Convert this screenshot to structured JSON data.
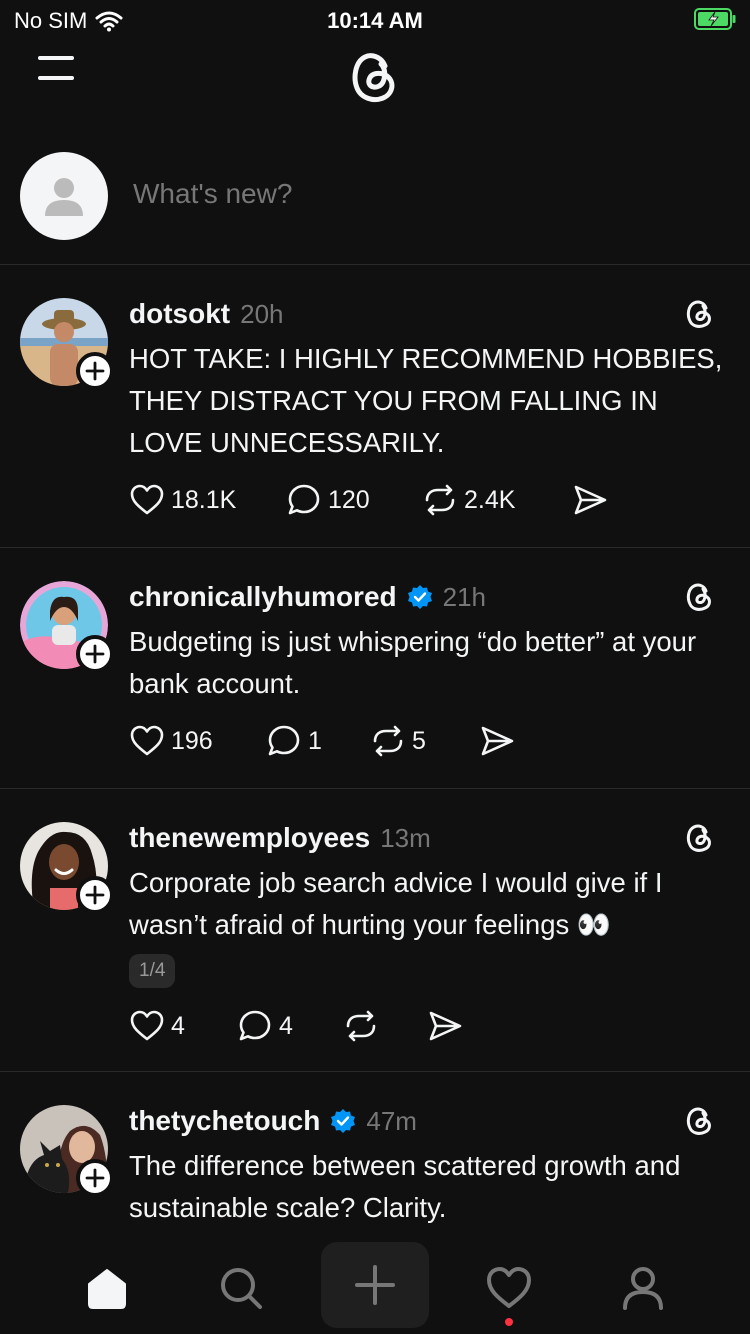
{
  "status": {
    "carrier": "No SIM",
    "time": "10:14 AM"
  },
  "composer": {
    "placeholder": "What's new?"
  },
  "posts": [
    {
      "username": "dotsokt",
      "verified": false,
      "time": "20h",
      "text": "HOT TAKE: I HIGHLY RECOMMEND HOBBIES, THEY DISTRACT YOU FROM FALLING IN LOVE UNNECESSARILY.",
      "likes": "18.1K",
      "replies": "120",
      "reposts": "2.4K"
    },
    {
      "username": "chronicallyhumored",
      "verified": true,
      "time": "21h",
      "text": "Budgeting is just whispering “do better” at your bank account.",
      "likes": "196",
      "replies": "1",
      "reposts": "5"
    },
    {
      "username": "thenewemployees",
      "verified": false,
      "time": "13m",
      "text": "Corporate job search advice I would give if I wasn’t afraid of hurting your feelings 👀",
      "page": "1/4",
      "likes": "4",
      "replies": "4",
      "reposts": ""
    },
    {
      "username": "thetychetouch",
      "verified": true,
      "time": "47m",
      "text": "The difference between scattered growth and sustainable scale? Clarity."
    }
  ],
  "colors": {
    "background": "#101010",
    "text": "#f3f5f7",
    "muted": "#777777",
    "verified": "#0095f6",
    "notification": "#ff3040",
    "battery": "#4cd964"
  },
  "icons": [
    "wifi-icon",
    "battery-icon",
    "menu-icon",
    "threads-logo-icon",
    "avatar-placeholder-icon",
    "plus-icon",
    "verified-icon",
    "heart-icon",
    "comment-icon",
    "repost-icon",
    "share-icon",
    "home-icon",
    "search-icon",
    "new-post-icon",
    "activity-icon",
    "profile-icon"
  ]
}
